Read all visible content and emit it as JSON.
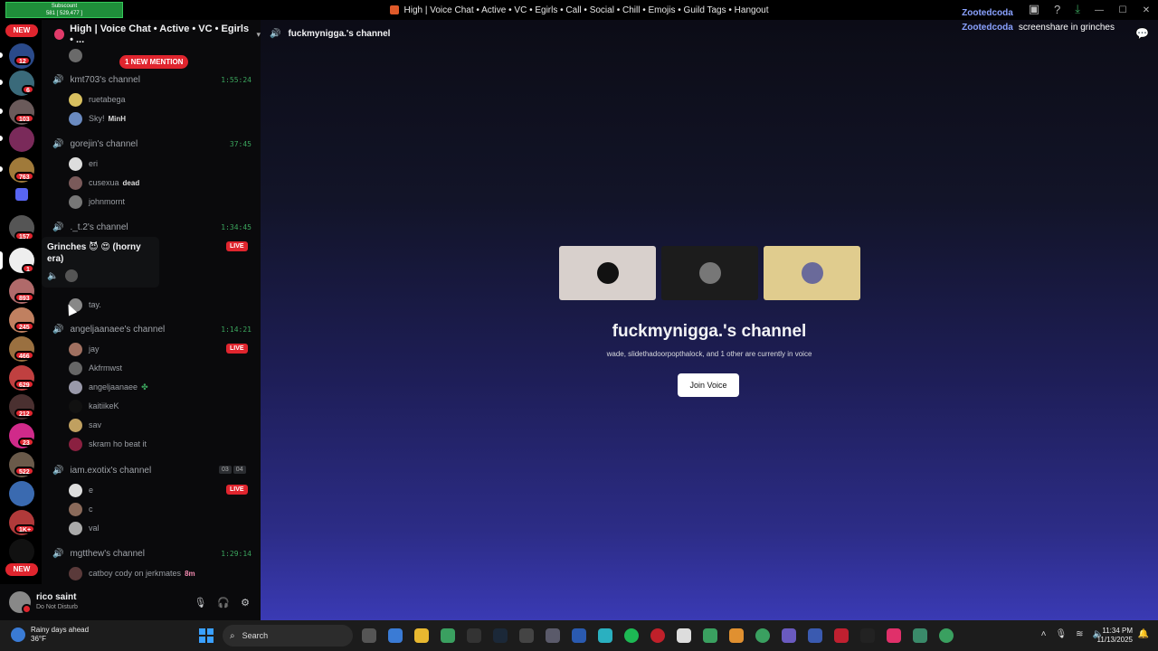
{
  "window": {
    "title": "High | Voice Chat • Active • VC • Egirls • Call • Social • Chill • Emojis • Guild Tags • Hangout",
    "top_badge_line1": "Subscount",
    "top_badge_line2": "581 [ 529,477 ]"
  },
  "rail": {
    "new_top": "NEW",
    "new_bottom": "NEW",
    "badges": [
      "12",
      "6",
      "103",
      "763",
      "157",
      "1",
      "893",
      "245",
      "466",
      "629",
      "212",
      "23",
      "522",
      "1K+"
    ]
  },
  "server": {
    "name": "High | Voice Chat • Active • VC • Egirls • ...",
    "mention_pill": "1 NEW MENTION"
  },
  "voice_channels": [
    {
      "name": "kmt703's channel",
      "timer": "1:55:24",
      "users": [
        "ruetabega",
        "Sky!"
      ],
      "user_tags": [
        "",
        "MinH"
      ]
    },
    {
      "name": "gorejin's channel",
      "timer": "37:45",
      "users": [
        "eri",
        "cusexua",
        "johnmornt"
      ],
      "user_tags": [
        "",
        "dead",
        ""
      ]
    },
    {
      "name": "._t.2's channel",
      "timer": "1:34:45",
      "users": [
        "",
        "tay."
      ]
    },
    {
      "name": "angeljaanaee's channel",
      "timer": "1:14:21",
      "users": [
        "jay",
        "Akfrmwst",
        "angeljaanaee",
        "kaitiikeK",
        "sav",
        "skram ho beat it"
      ]
    },
    {
      "name": "iam.exotix's channel",
      "count_a": "03",
      "count_b": "04",
      "users": [
        "e",
        "c",
        "val"
      ]
    },
    {
      "name": "mgtthew's channel",
      "timer": "1:29:14",
      "users": [
        "catboy cody on jerkmates"
      ],
      "user_tags": [
        "8m"
      ]
    }
  ],
  "live_label": "LIVE",
  "tooltip": {
    "title": "Grinches 😈 😍 (horny era)"
  },
  "self_user": {
    "name": "rico saint",
    "status": "Do Not Disturb"
  },
  "main": {
    "header_channel": "fuckmynigga.'s channel",
    "overlay_user1": "Zootedcoda",
    "overlay_user2": "Zootedcoda",
    "overlay_msg": "screenshare in grinches",
    "vc_title": "fuckmynigga.'s channel",
    "vc_subtitle": "wade, slidethadoorpopthalock, and 1 other are currently in voice",
    "join_label": "Join Voice",
    "tile_colors": [
      "#d8d0cc",
      "#1c1c1c",
      "#e0cc8e"
    ]
  },
  "taskbar": {
    "weather_title": "Rainy days ahead",
    "weather_temp": "36°F",
    "search_label": "Search",
    "time": "11:34 PM",
    "date": "11/13/2025"
  },
  "colors": {
    "live_red": "#e0252e",
    "voice_green": "#3ba55d",
    "join_bg": "#ffffff"
  }
}
